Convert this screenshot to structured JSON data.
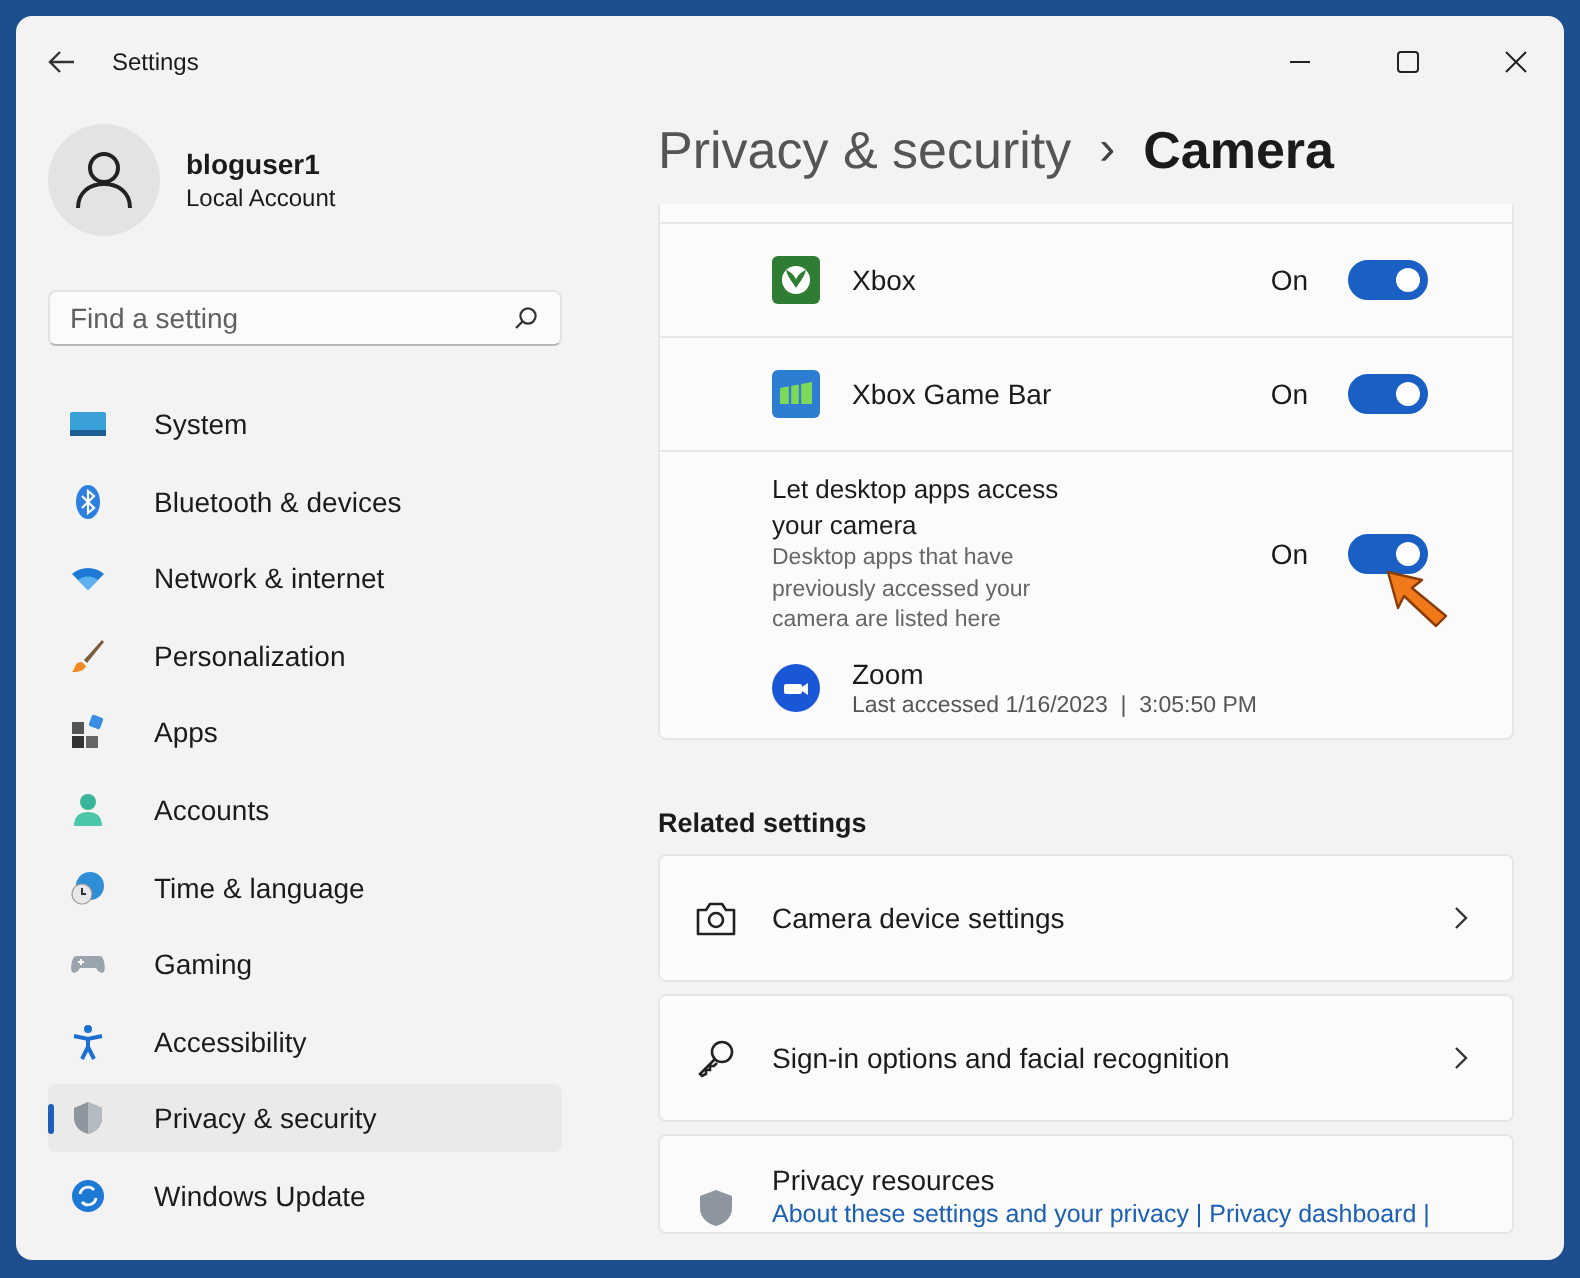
{
  "window": {
    "title": "Settings"
  },
  "user": {
    "name": "bloguser1",
    "account_type": "Local Account"
  },
  "search": {
    "placeholder": "Find a setting"
  },
  "sidebar": {
    "items": [
      {
        "label": "System",
        "kind": "system",
        "selected": false
      },
      {
        "label": "Bluetooth & devices",
        "kind": "bluetooth",
        "selected": false
      },
      {
        "label": "Network & internet",
        "kind": "network",
        "selected": false
      },
      {
        "label": "Personalization",
        "kind": "personalization",
        "selected": false
      },
      {
        "label": "Apps",
        "kind": "apps",
        "selected": false
      },
      {
        "label": "Accounts",
        "kind": "accounts",
        "selected": false
      },
      {
        "label": "Time & language",
        "kind": "time",
        "selected": false
      },
      {
        "label": "Gaming",
        "kind": "gaming",
        "selected": false
      },
      {
        "label": "Accessibility",
        "kind": "accessibility",
        "selected": false
      },
      {
        "label": "Privacy & security",
        "kind": "privacy",
        "selected": true
      },
      {
        "label": "Windows Update",
        "kind": "update",
        "selected": false
      }
    ]
  },
  "breadcrumb": {
    "parent": "Privacy & security",
    "separator": "›",
    "current": "Camera"
  },
  "apps": [
    {
      "name": "Xbox",
      "kind": "xbox",
      "state_label": "On",
      "on": true
    },
    {
      "name": "Xbox Game Bar",
      "kind": "gamebar",
      "state_label": "On",
      "on": true
    }
  ],
  "desktop_apps": {
    "title": "Let desktop apps access your camera",
    "description": "Desktop apps that have previously accessed your camera are listed here",
    "state_label": "On",
    "on": true,
    "apps": [
      {
        "name": "Zoom",
        "last_accessed": "Last accessed 1/16/2023  |  3:05:50 PM"
      }
    ]
  },
  "related": {
    "heading": "Related settings",
    "items": [
      {
        "label": "Camera device settings",
        "kind": "link"
      },
      {
        "label": "Sign-in options and facial recognition",
        "kind": "link"
      },
      {
        "label": "Privacy resources",
        "kind": "resources",
        "links": "About these settings and your privacy | Privacy dashboard |"
      }
    ]
  }
}
